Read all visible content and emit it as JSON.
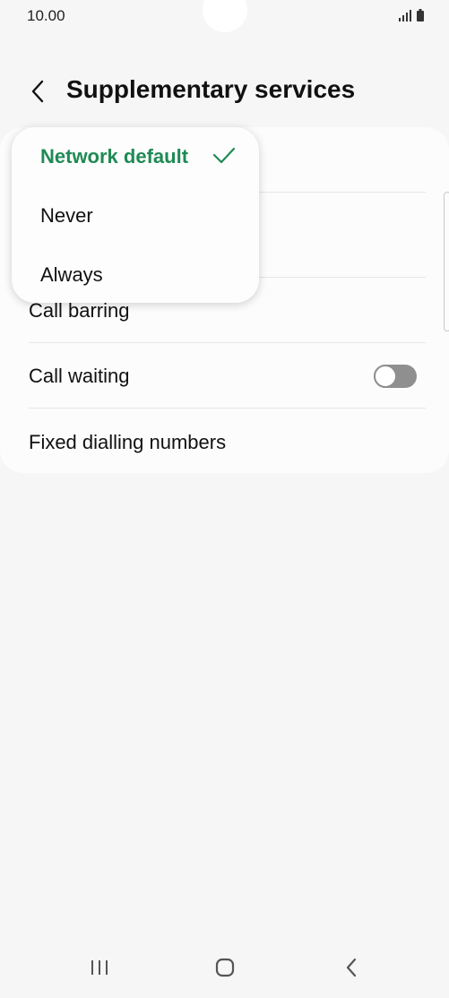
{
  "status_bar": {
    "time": "10.00"
  },
  "header": {
    "title": "Supplementary services"
  },
  "settings": {
    "rows": [
      {
        "label": ""
      },
      {
        "label": ""
      },
      {
        "label": "Call barring"
      },
      {
        "label": "Call waiting",
        "toggle_on": false
      },
      {
        "label": "Fixed dialling numbers"
      }
    ]
  },
  "menu": {
    "items": [
      {
        "label": "Network default",
        "selected": true
      },
      {
        "label": "Never",
        "selected": false
      },
      {
        "label": "Always",
        "selected": false
      }
    ]
  },
  "colors": {
    "accent": "#1f8a55",
    "background": "#f6f6f6",
    "card": "#fcfcfc",
    "toggle_off": "#8f8f8f"
  },
  "icons": {
    "back": "chevron-left-icon",
    "check": "check-icon",
    "nav_recents": "recents-icon",
    "nav_home": "home-icon",
    "nav_back": "back-icon"
  }
}
